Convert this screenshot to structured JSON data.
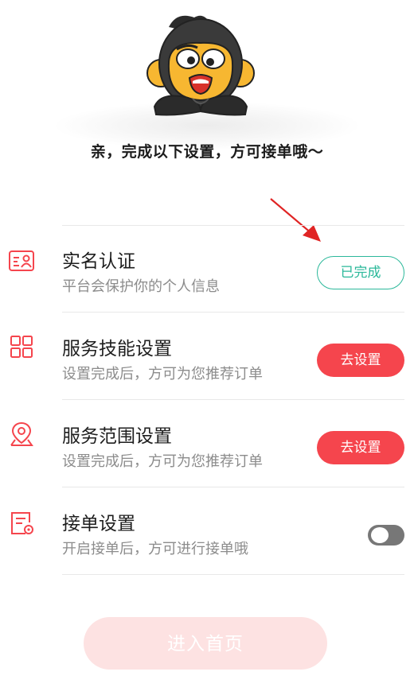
{
  "header": {
    "mascot": "monkey-mascot",
    "headline": "亲，完成以下设置，方可接单哦～"
  },
  "tasks": [
    {
      "title": "实名认证",
      "subtitle": "平台会保护你的个人信息",
      "icon": "id-card-icon",
      "action_label": "已完成",
      "status": "done"
    },
    {
      "title": "服务技能设置",
      "subtitle": "设置完成后，方可为您推荐订单",
      "icon": "grid-icon",
      "action_label": "去设置",
      "status": "todo"
    },
    {
      "title": "服务范围设置",
      "subtitle": "设置完成后，方可为您推荐订单",
      "icon": "location-pin-icon",
      "action_label": "去设置",
      "status": "todo"
    },
    {
      "title": "接单设置",
      "subtitle": "开启接单后，方可进行接单哦",
      "icon": "order-settings-icon",
      "toggle_on": false
    }
  ],
  "colors": {
    "accent_red": "#f5454d",
    "done_green": "#2bb89a",
    "enter_button_disabled": "#fde2e2"
  },
  "footer": {
    "enter_label": "进入首页"
  }
}
